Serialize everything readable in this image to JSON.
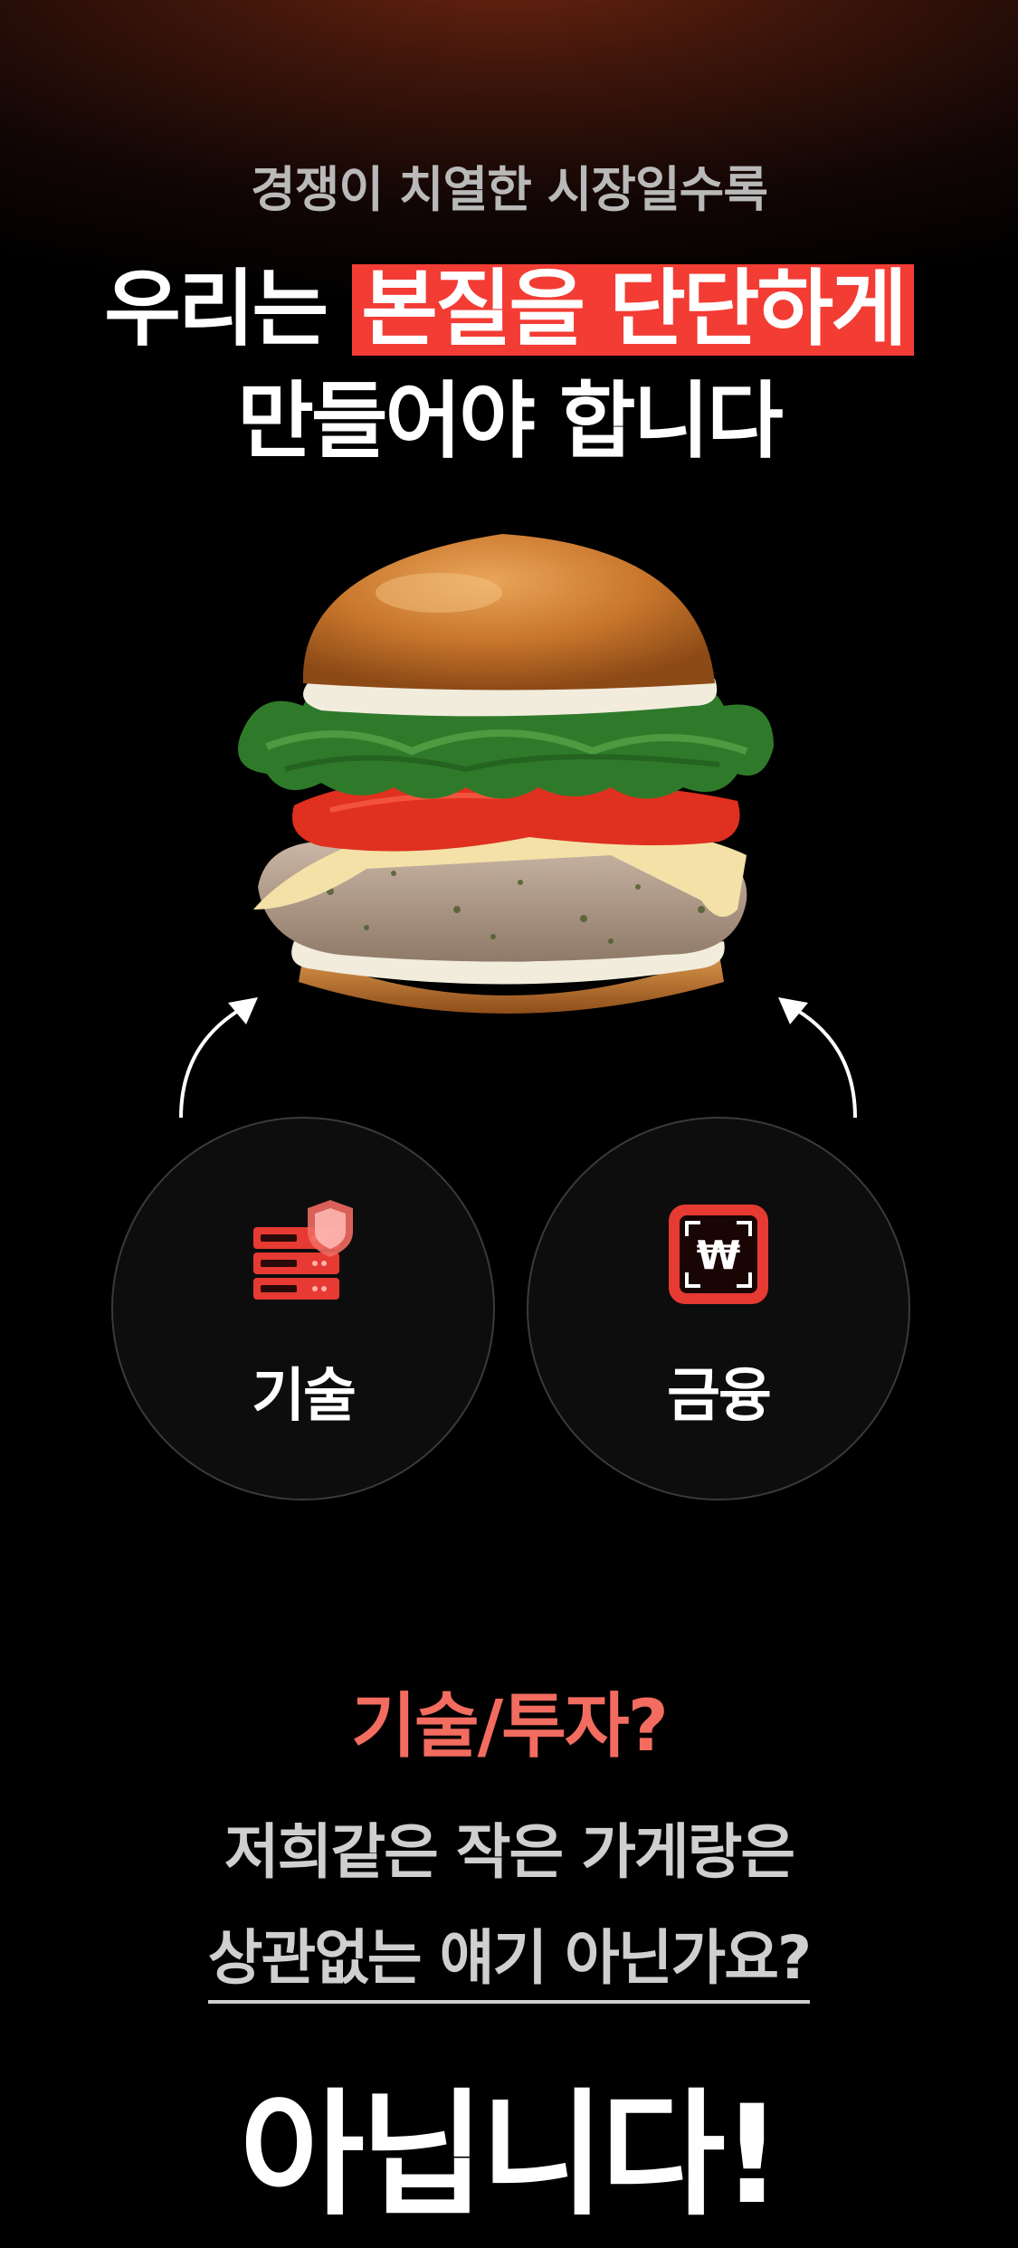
{
  "headline": {
    "sub": "경쟁이 치열한 시장일수록",
    "line1_prefix": "우리는 ",
    "line1_highlight": "본질을 단단하게",
    "line2": "만들어야 합니다"
  },
  "pillars": [
    {
      "label": "기술",
      "icon": "server-shield-icon"
    },
    {
      "label": "금융",
      "icon": "won-currency-icon"
    }
  ],
  "question": {
    "title": "기술/투자?",
    "line1": "저희같은 작은 가게랑은",
    "line2": "상관없는 얘기 아닌가요?"
  },
  "answer": "아닙니다!",
  "colors": {
    "accent": "#f23c34",
    "question_title": "#f36c60",
    "background": "#000000"
  }
}
